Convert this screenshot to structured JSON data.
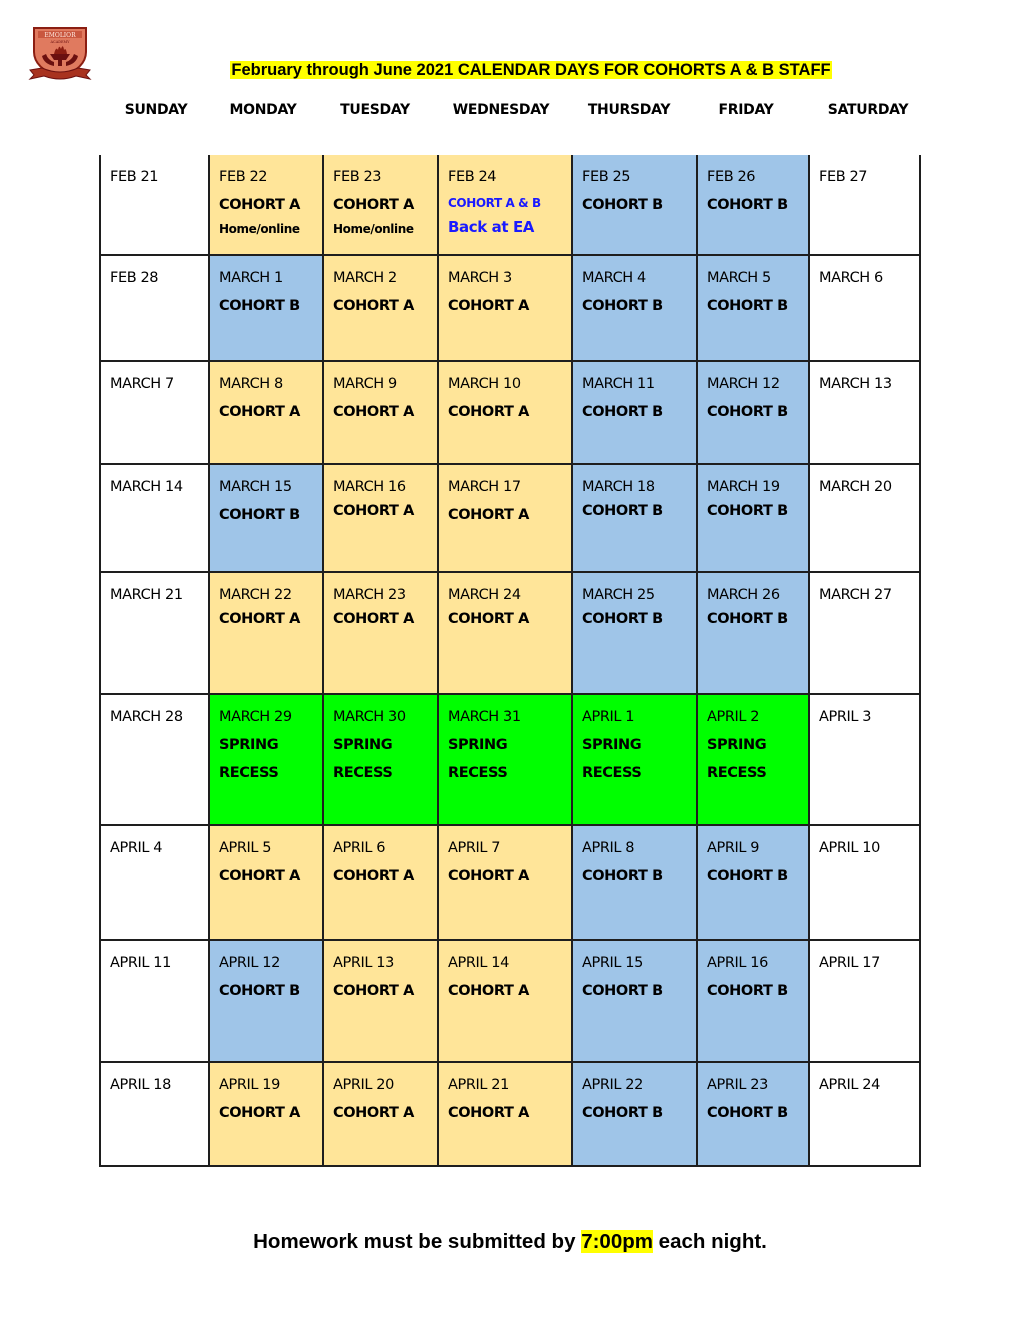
{
  "logo": {
    "name": "Emolior Academy crest",
    "text": "EMOLIOR",
    "subtext": "ACADEMY"
  },
  "title": "February through June 2021 CALENDAR DAYS FOR COHORTS A & B STAFF",
  "colors": {
    "cohort_a": "#ffe599",
    "cohort_b": "#9fc5e8",
    "spring_recess": "#00ff00",
    "weekend": "#ffffff",
    "highlight": "#ffff00",
    "blue_text": "#1a1aff"
  },
  "days": [
    "SUNDAY",
    "MONDAY",
    "TUESDAY",
    "WEDNESDAY",
    "THURSDAY",
    "FRIDAY",
    "SATURDAY"
  ],
  "weeks": [
    [
      {
        "date": "FEB 21",
        "type": "weekend",
        "lines": []
      },
      {
        "date": "FEB 22",
        "type": "cohort_a",
        "lines": [
          "COHORT A"
        ],
        "sub": "Home/online"
      },
      {
        "date": "FEB 23",
        "type": "cohort_a",
        "lines": [
          "COHORT A"
        ],
        "sub": "Home/online"
      },
      {
        "date": "FEB 24",
        "type": "cohort_a",
        "blue_small": "COHORT A & B",
        "blue_big": "Back at EA"
      },
      {
        "date": "FEB 25",
        "type": "cohort_b",
        "lines": [
          "COHORT B"
        ]
      },
      {
        "date": "FEB 26",
        "type": "cohort_b",
        "lines": [
          "COHORT B"
        ]
      },
      {
        "date": "FEB 27",
        "type": "weekend",
        "lines": []
      }
    ],
    [
      {
        "date": "FEB 28",
        "type": "weekend",
        "lines": []
      },
      {
        "date": "MARCH 1",
        "type": "cohort_b",
        "lines": [
          "COHORT B"
        ]
      },
      {
        "date": "MARCH 2",
        "type": "cohort_a",
        "lines": [
          "COHORT A"
        ]
      },
      {
        "date": "MARCH 3",
        "type": "cohort_a",
        "lines": [
          "COHORT A"
        ]
      },
      {
        "date": "MARCH 4",
        "type": "cohort_b",
        "lines": [
          "COHORT B"
        ]
      },
      {
        "date": "MARCH 5",
        "type": "cohort_b",
        "lines": [
          "COHORT B"
        ]
      },
      {
        "date": "MARCH 6",
        "type": "weekend",
        "lines": []
      }
    ],
    [
      {
        "date": "MARCH 7",
        "type": "weekend",
        "lines": []
      },
      {
        "date": "MARCH 8",
        "type": "cohort_a",
        "lines": [
          "COHORT A"
        ]
      },
      {
        "date": "MARCH 9",
        "type": "cohort_a",
        "lines": [
          "COHORT A"
        ]
      },
      {
        "date": "MARCH 10",
        "type": "cohort_a",
        "lines": [
          "COHORT A"
        ]
      },
      {
        "date": "MARCH 11",
        "type": "cohort_b",
        "lines": [
          "COHORT B"
        ]
      },
      {
        "date": "MARCH 12",
        "type": "cohort_b",
        "lines": [
          "COHORT B"
        ]
      },
      {
        "date": "MARCH 13",
        "type": "weekend",
        "lines": []
      }
    ],
    [
      {
        "date": "MARCH 14",
        "type": "weekend",
        "lines": []
      },
      {
        "date": "MARCH 15",
        "type": "cohort_b",
        "lines": [
          "COHORT B"
        ]
      },
      {
        "date": "MARCH 16",
        "type": "cohort_a",
        "lines": [
          "COHORT A"
        ],
        "tight": true
      },
      {
        "date": "MARCH 17",
        "type": "cohort_a",
        "lines": [
          "COHORT A"
        ]
      },
      {
        "date": "MARCH 18",
        "type": "cohort_b",
        "lines": [
          "COHORT B"
        ],
        "tight": true
      },
      {
        "date": "MARCH 19",
        "type": "cohort_b",
        "lines": [
          "COHORT B"
        ],
        "tight": true
      },
      {
        "date": "MARCH 20",
        "type": "weekend",
        "lines": []
      }
    ],
    [
      {
        "date": "MARCH 21",
        "type": "weekend",
        "lines": []
      },
      {
        "date": "MARCH 22",
        "type": "cohort_a",
        "lines": [
          "COHORT A"
        ],
        "tight": true
      },
      {
        "date": "MARCH 23",
        "type": "cohort_a",
        "lines": [
          "COHORT A"
        ],
        "tight": true
      },
      {
        "date": "MARCH 24",
        "type": "cohort_a",
        "lines": [
          "COHORT A"
        ],
        "tight": true
      },
      {
        "date": "MARCH 25",
        "type": "cohort_b",
        "lines": [
          "COHORT B"
        ],
        "tight": true
      },
      {
        "date": "MARCH 26",
        "type": "cohort_b",
        "lines": [
          "COHORT B"
        ],
        "tight": true
      },
      {
        "date": "MARCH 27",
        "type": "weekend",
        "lines": []
      }
    ],
    [
      {
        "date": "MARCH 28",
        "type": "weekend",
        "lines": []
      },
      {
        "date": "MARCH 29",
        "type": "spring_recess",
        "lines": [
          "SPRING",
          "RECESS"
        ]
      },
      {
        "date": "MARCH 30",
        "type": "spring_recess",
        "lines": [
          "SPRING",
          "RECESS"
        ]
      },
      {
        "date": "MARCH 31",
        "type": "spring_recess",
        "lines": [
          "SPRING",
          "RECESS"
        ]
      },
      {
        "date": "APRIL 1",
        "type": "spring_recess",
        "lines": [
          "SPRING",
          "RECESS"
        ]
      },
      {
        "date": "APRIL 2",
        "type": "spring_recess",
        "lines": [
          "SPRING",
          "RECESS"
        ]
      },
      {
        "date": "APRIL 3",
        "type": "weekend",
        "lines": []
      }
    ],
    [
      {
        "date": "APRIL 4",
        "type": "weekend",
        "lines": []
      },
      {
        "date": "APRIL 5",
        "type": "cohort_a",
        "lines": [
          "COHORT A"
        ]
      },
      {
        "date": "APRIL 6",
        "type": "cohort_a",
        "lines": [
          "COHORT A"
        ]
      },
      {
        "date": "APRIL 7",
        "type": "cohort_a",
        "lines": [
          "COHORT A"
        ]
      },
      {
        "date": "APRIL 8",
        "type": "cohort_b",
        "lines": [
          "COHORT B"
        ]
      },
      {
        "date": "APRIL 9",
        "type": "cohort_b",
        "lines": [
          "COHORT B"
        ]
      },
      {
        "date": "APRIL 10",
        "type": "weekend",
        "lines": []
      }
    ],
    [
      {
        "date": "APRIL 11",
        "type": "weekend",
        "lines": []
      },
      {
        "date": "APRIL 12",
        "type": "cohort_b",
        "lines": [
          "COHORT B"
        ]
      },
      {
        "date": "APRIL 13",
        "type": "cohort_a",
        "lines": [
          "COHORT A"
        ]
      },
      {
        "date": "APRIL 14",
        "type": "cohort_a",
        "lines": [
          "COHORT A"
        ]
      },
      {
        "date": "APRIL 15",
        "type": "cohort_b",
        "lines": [
          "COHORT B"
        ]
      },
      {
        "date": "APRIL 16",
        "type": "cohort_b",
        "lines": [
          "COHORT B"
        ]
      },
      {
        "date": "APRIL 17",
        "type": "weekend",
        "lines": []
      }
    ],
    [
      {
        "date": "APRIL 18",
        "type": "weekend",
        "lines": []
      },
      {
        "date": "APRIL 19",
        "type": "cohort_a",
        "lines": [
          "COHORT A"
        ]
      },
      {
        "date": "APRIL 20",
        "type": "cohort_a",
        "lines": [
          "COHORT A"
        ]
      },
      {
        "date": "APRIL 21",
        "type": "cohort_a",
        "lines": [
          "COHORT A"
        ]
      },
      {
        "date": "APRIL 22",
        "type": "cohort_b",
        "lines": [
          "COHORT B"
        ]
      },
      {
        "date": "APRIL 23",
        "type": "cohort_b",
        "lines": [
          "COHORT B"
        ]
      },
      {
        "date": "APRIL 24",
        "type": "weekend",
        "lines": []
      }
    ]
  ],
  "footer": {
    "before": "Homework must be submitted by ",
    "highlight": "7:00pm",
    "after": " each night."
  }
}
